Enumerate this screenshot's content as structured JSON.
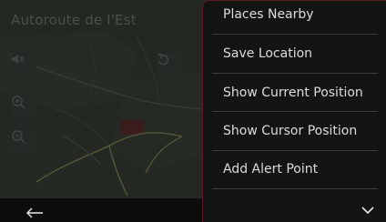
{
  "map": {
    "street_name": "Autoroute de l'Est",
    "controls": {
      "mute_icon": "speaker-mute-icon",
      "undo_icon": "undo-icon",
      "zoom_in_icon": "zoom-in-icon",
      "zoom_out_icon": "zoom-out-icon"
    }
  },
  "menu": {
    "items": [
      {
        "label": "Places Nearby"
      },
      {
        "label": "Save Location"
      },
      {
        "label": "Show Current Position"
      },
      {
        "label": "Show Cursor Position"
      },
      {
        "label": "Add Alert Point"
      }
    ]
  },
  "bottom_bar": {
    "back_icon": "back-arrow-icon",
    "down_icon": "chevron-down-icon"
  },
  "colors": {
    "panel_border": "#5a1a1e",
    "menu_background": "#141414",
    "menu_text": "#dcdcdc"
  }
}
